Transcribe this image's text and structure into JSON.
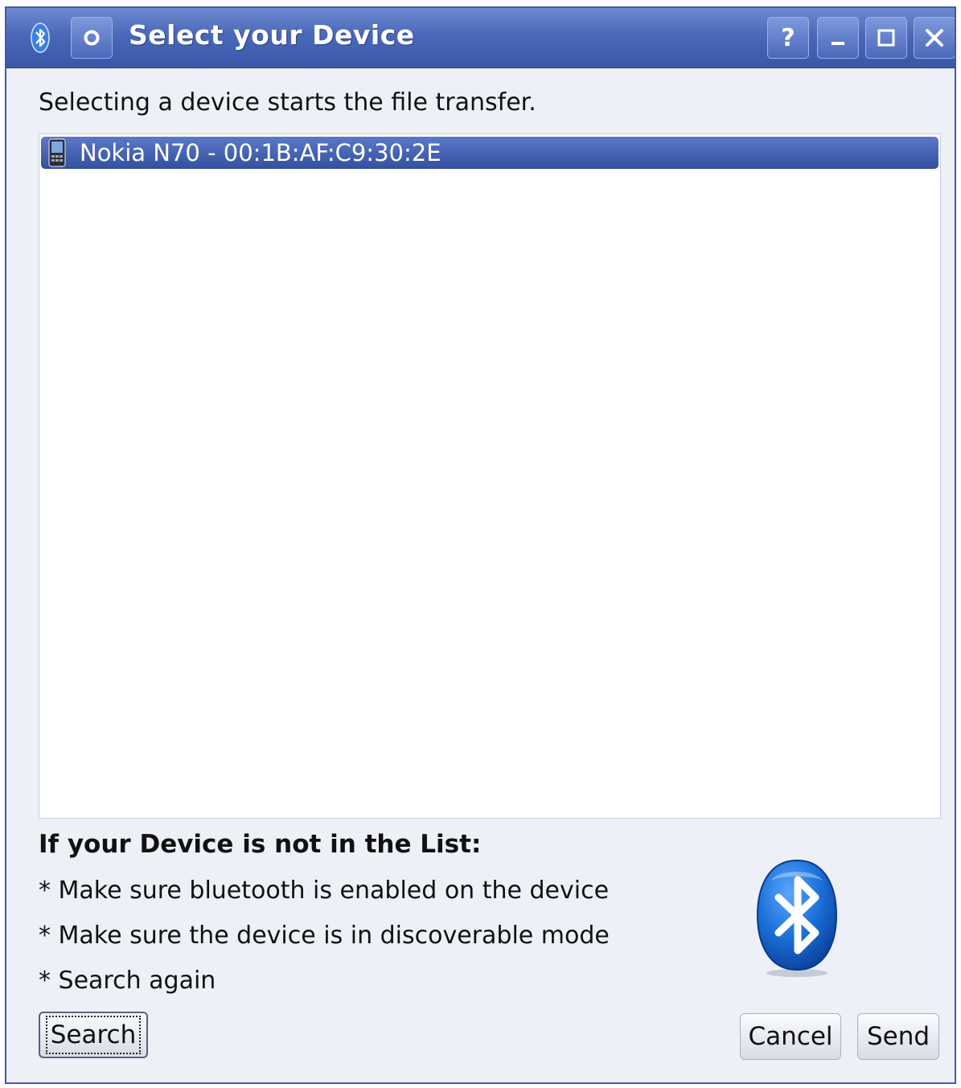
{
  "window": {
    "title": "Select your Device",
    "buttons": {
      "help": "?",
      "minimize": "_",
      "maximize": "□",
      "close": "✕"
    }
  },
  "intro_text": "Selecting a device starts the file transfer.",
  "devices": [
    {
      "label": "Nokia N70 - 00:1B:AF:C9:30:2E",
      "selected": true,
      "icon": "phone-icon"
    }
  ],
  "help": {
    "heading": "If your Device is not in the List:",
    "lines": [
      "* Make sure bluetooth is enabled on the device",
      "* Make sure the device is in discoverable mode",
      "* Search again"
    ]
  },
  "buttons": {
    "search": "Search",
    "cancel": "Cancel",
    "send": "Send"
  },
  "colors": {
    "titlebar": "#4a68b8",
    "selection": "#3f5ca8",
    "bluetooth_blue": "#1a6fd6"
  }
}
